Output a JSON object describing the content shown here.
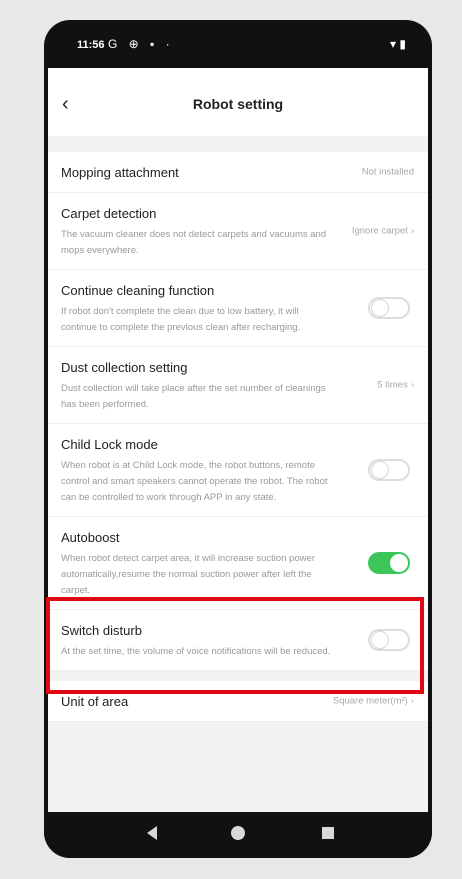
{
  "status_bar": {
    "time": "11:56",
    "icons": "G ⊕ ▪ ·",
    "right_icons": "▾ ▮"
  },
  "header": {
    "back_icon": "chevron-left-icon",
    "title": "Robot setting"
  },
  "rows": [
    {
      "title": "Mopping attachment",
      "value": "Not installed"
    },
    {
      "title": "Carpet detection",
      "desc": "The vacuum cleaner does not detect carpets and vacuums and mops everywhere.",
      "value": "Ignore carpet"
    },
    {
      "title": "Continue cleaning function",
      "desc": "If robot don't complete the clean due to low battery, it will continue to complete the previous clean after recharging.",
      "toggle": false
    },
    {
      "title": "Dust collection setting",
      "desc": "Dust collection will take place after the set number of cleanings has been performed.",
      "value": "5 times"
    },
    {
      "title": "Child Lock mode",
      "desc": "When robot is at Child Lock mode, the robot buttons, remote control and smart speakers cannot operate the robot. The robot can be controlled to work through APP in any state.",
      "toggle": false
    },
    {
      "title": "Autoboost",
      "desc": "When robot detect carpet area, it will increase suction power automatically,resume the normal suction power after left the carpet.",
      "toggle": true
    },
    {
      "title": "Switch disturb",
      "desc": "At the set time, the volume of voice notifications will be reduced.",
      "toggle": false
    },
    {
      "title": "Unit of area",
      "value": "Square meter(m²)"
    }
  ],
  "chevron": "›",
  "colors": {
    "toggle_on": "#3cc65a",
    "highlight": "#e30613"
  }
}
